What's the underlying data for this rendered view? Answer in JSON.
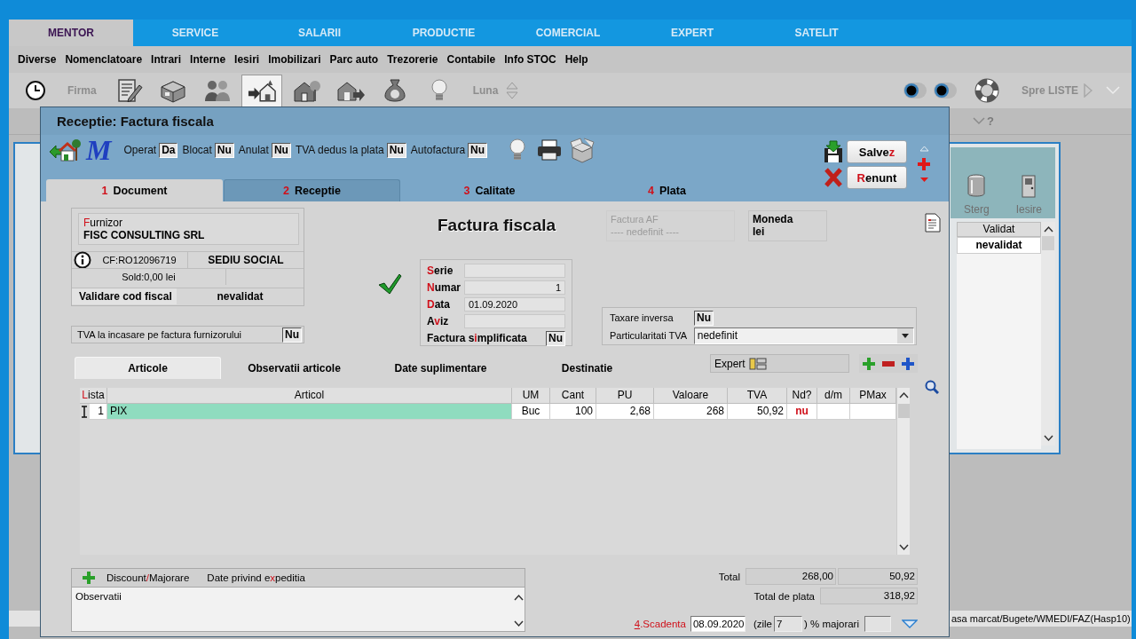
{
  "app_tabs": [
    {
      "label": "MENTOR",
      "selected": true
    },
    {
      "label": "SERVICE",
      "selected": false
    },
    {
      "label": "SALARII",
      "selected": false
    },
    {
      "label": "PRODUCTIE",
      "selected": false
    },
    {
      "label": "COMERCIAL",
      "selected": false
    },
    {
      "label": "EXPERT",
      "selected": false
    },
    {
      "label": "SATELIT",
      "selected": false
    }
  ],
  "menu": [
    "Diverse",
    "Nomenclatoare",
    "Intrari",
    "Interne",
    "Iesiri",
    "Imobilizari",
    "Parc auto",
    "Trezorerie",
    "Contabile",
    "Info STOC",
    "Help"
  ],
  "toolbar": {
    "company": {
      "label": "Firma",
      "disabled": true
    },
    "tools": [
      {
        "selected": false
      },
      {
        "selected": false
      },
      {
        "selected": false
      },
      {
        "selected": true
      },
      {
        "selected": false
      },
      {
        "selected": false
      },
      {
        "selected": false
      },
      {
        "selected": false
      }
    ],
    "month": {
      "label": "Luna",
      "disabled": true
    },
    "lists_label": "Spre LISTE"
  },
  "list_window": {
    "help_mark": "?",
    "actions": [
      {
        "kind": "delete",
        "label": "Sterg"
      },
      {
        "kind": "exit",
        "label": "Iesire"
      }
    ],
    "column": "Validat",
    "cell": "nevalidat"
  },
  "status_bar": "asa marcat/Bugete/WMEDI/FAZ(Hasp10)",
  "dialog": {
    "title": "Receptie: Factura fiscala",
    "logo": "M",
    "flags": [
      {
        "label": "Operat",
        "value": "Da"
      },
      {
        "label": "Blocat",
        "value": "Nu"
      },
      {
        "label": "Anulat",
        "value": "Nu"
      },
      {
        "label": "TVA dedus la plata",
        "value": "Nu"
      },
      {
        "label": "Autofactura",
        "value": "Nu"
      }
    ],
    "actions": [
      {
        "kind": "save",
        "label": {
          "pre": "Salve",
          "key": "z"
        }
      },
      {
        "kind": "cancel",
        "label": {
          "key": "R",
          "post": "enunt"
        }
      }
    ],
    "nav": [
      {
        "kind": "up",
        "disabled": true
      },
      {
        "kind": "add",
        "disabled": false
      },
      {
        "kind": "down",
        "disabled": false
      }
    ],
    "tabs": [
      {
        "number": "1",
        "label": "Document",
        "selected": true,
        "hovered": false
      },
      {
        "number": "2",
        "label": "Receptie",
        "selected": false,
        "hovered": true
      },
      {
        "number": "3",
        "label": "Calitate",
        "selected": false,
        "hovered": false
      },
      {
        "number": "4",
        "label": "Plata",
        "selected": false,
        "hovered": false
      }
    ],
    "supplier": {
      "label": {
        "key": "F",
        "post": "urnizor"
      },
      "name": "FISC CONSULTING SRL",
      "fiscal_code": "CF:RO12096719",
      "address": "SEDIU SOCIAL",
      "balance": "Sold:0,00 lei",
      "validation_label": "Validare cod fiscal",
      "validation": "nevalidat"
    },
    "vat_on_receipt": {
      "label": "TVA la incasare pe factura furnizorului",
      "value": "Nu"
    },
    "document_type": "Factura fiscala",
    "document_valid": true,
    "fields": [
      {
        "kind": "text",
        "label": {
          "key": "S",
          "post": "erie"
        }
      },
      {
        "kind": "number",
        "label": {
          "key": "N",
          "post": "umar"
        },
        "value": "1"
      },
      {
        "kind": "text",
        "label": {
          "key": "D",
          "post": "ata"
        },
        "value": "01.09.2020"
      },
      {
        "kind": "text",
        "label": {
          "pre": "A",
          "key": "v",
          "post": "iz"
        }
      },
      {
        "kind": "flag",
        "label": {
          "pre": "Factura s",
          "key": "i",
          "post": "mplificata"
        },
        "value": "Nu"
      }
    ],
    "af_invoice": {
      "label": "Factura AF",
      "value": "---- nedefinit ----",
      "disabled": true
    },
    "currency": {
      "label": "Moneda",
      "value": "lei"
    },
    "vat": {
      "reverse_label": "Taxare inversa",
      "reverse": "Nu",
      "particular_label": "Particularitati TVA",
      "particular": "nedefinit"
    },
    "subtabs": [
      {
        "label": "Articole",
        "selected": true
      },
      {
        "label": "Observatii articole",
        "selected": false
      },
      {
        "label": "Date suplimentare",
        "selected": false
      },
      {
        "label": "Destinatie",
        "selected": false
      }
    ],
    "expert_label": "Expert",
    "table": {
      "columns": [
        {
          "label": {
            "key": "L",
            "post": "ista"
          },
          "kind": "index"
        },
        {
          "label": "Articol",
          "kind": "name"
        },
        {
          "label": "UM",
          "kind": "center"
        },
        {
          "label": "Cant",
          "kind": "num"
        },
        {
          "label": "PU",
          "kind": "num"
        },
        {
          "label": "Valoare",
          "kind": "num"
        },
        {
          "label": "TVA",
          "kind": "num"
        },
        {
          "label": "Nd?",
          "kind": "flag"
        },
        {
          "label": "d/m",
          "kind": "center"
        },
        {
          "label": "PMax",
          "kind": "num"
        }
      ],
      "rows": [
        {
          "current": true,
          "selected": true,
          "cells": [
            "1",
            "PIX",
            "Buc",
            "100",
            "2,68",
            "268",
            "50,92",
            "nu"
          ]
        }
      ]
    },
    "bottom_tabs": [
      {
        "pre": "Discount",
        "key": "/",
        "post": "Majorare"
      },
      {
        "pre": "Date privind e",
        "key": "x",
        "post": "peditia"
      }
    ],
    "notes_label": "Observatii",
    "totals": {
      "total_label": "Total",
      "net": "268,00",
      "vat": "50,92",
      "payable_label": "Total de plata",
      "payable": "318,92"
    },
    "due": {
      "label": {
        "key": "4",
        "post": ".Scadenta"
      },
      "date": "08.09.2020",
      "days_prefix": "(zile",
      "days": "7",
      "penalty_label": ") % majorari"
    }
  }
}
